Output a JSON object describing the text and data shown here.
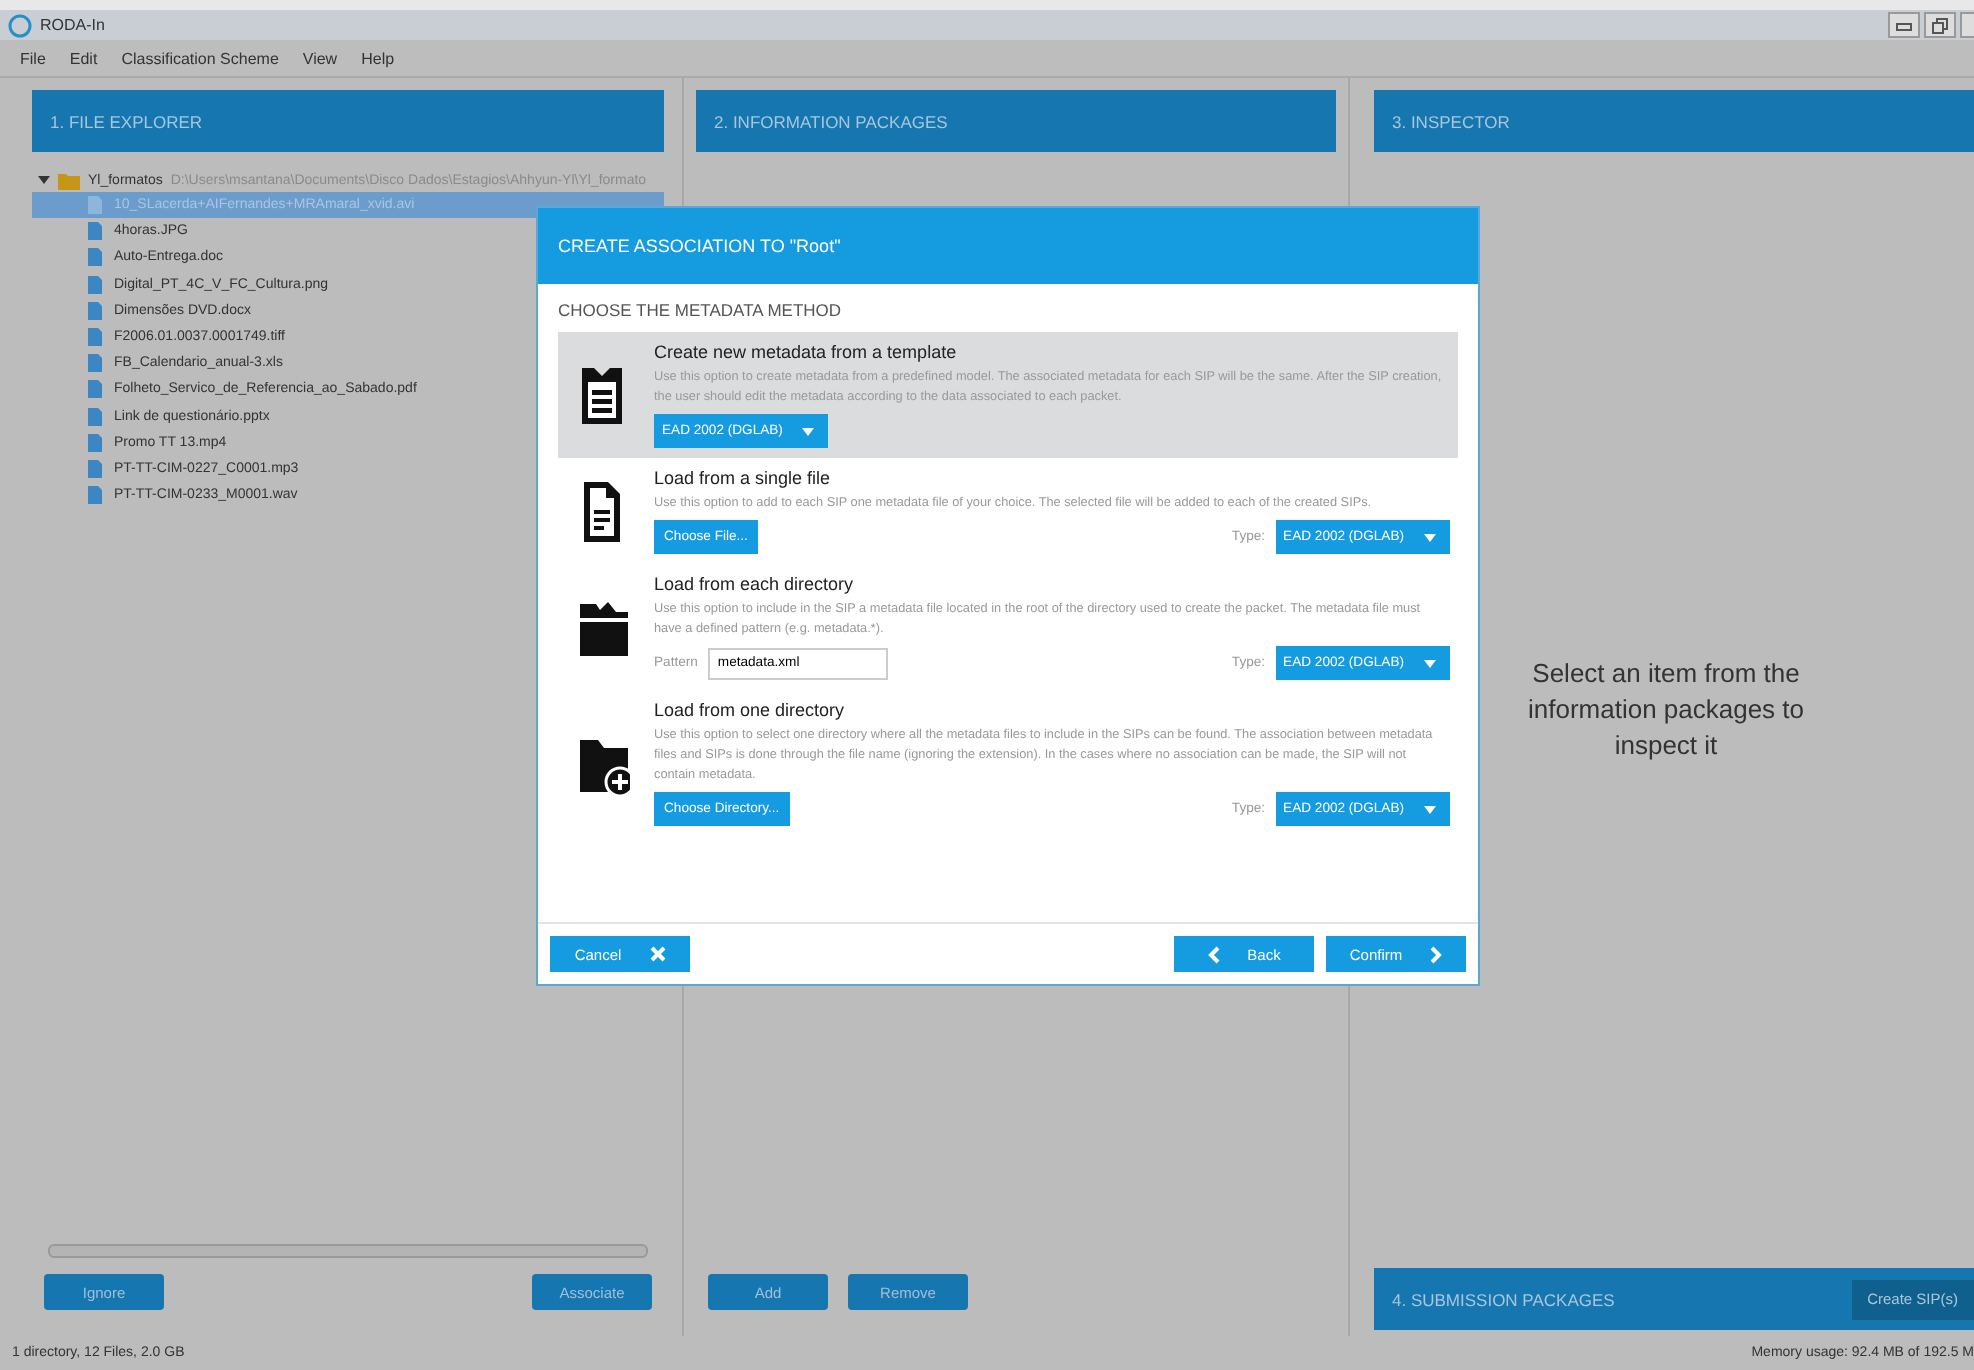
{
  "window": {
    "title": "RODA-In"
  },
  "menu": [
    "File",
    "Edit",
    "Classification Scheme",
    "View",
    "Help"
  ],
  "file_explorer": {
    "title": "1. FILE EXPLORER",
    "root": {
      "name": "Yl_formatos",
      "path": "D:\\Users\\msantana\\Documents\\Disco Dados\\Estagios\\Ahhyun-Yl\\Yl_formato",
      "expanded": true,
      "children": [
        {
          "name": "10_SLacerda+AIFernandes+MRAmaral_xvid.avi",
          "selected": true
        },
        {
          "name": "4horas.JPG",
          "selected": false
        },
        {
          "name": "Auto-Entrega.doc",
          "selected": false
        },
        {
          "name": "Digital_PT_4C_V_FC_Cultura.png",
          "selected": false
        },
        {
          "name": "Dimensões DVD.docx",
          "selected": false
        },
        {
          "name": "F2006.01.0037.0001749.tiff",
          "selected": false
        },
        {
          "name": "FB_Calendario_anual-3.xls",
          "selected": false
        },
        {
          "name": "Folheto_Servico_de_Referencia_ao_Sabado.pdf",
          "selected": false
        },
        {
          "name": "Link de questionário.pptx",
          "selected": false
        },
        {
          "name": "Promo TT 13.mp4",
          "selected": false
        },
        {
          "name": "PT-TT-CIM-0227_C0001.mp3",
          "selected": false
        },
        {
          "name": "PT-TT-CIM-0233_M0001.wav",
          "selected": false
        }
      ]
    },
    "buttons": [
      "Ignore",
      "Associate"
    ]
  },
  "information_packages": {
    "title": "2. INFORMATION PACKAGES",
    "buttons": [
      "Add",
      "Remove"
    ]
  },
  "inspector": {
    "title": "3. INSPECTOR",
    "message": "Select an item from the information packages to inspect it"
  },
  "submission_packages": {
    "title": "4. SUBMISSION PACKAGES",
    "button": "Create SIP(s)"
  },
  "status_bar": {
    "left": "1 directory, 12 Files, 2.0 GB",
    "right": "Memory usage: 92.4 MB of 192.5 M"
  },
  "dialog": {
    "title": "CREATE ASSOCIATION TO \"Root\"",
    "subtitle": "CHOOSE THE METADATA METHOD",
    "options": [
      {
        "kind": "template",
        "selected": true,
        "title": "Create new metadata from a template",
        "description": "Use this option to create metadata from a predefined model. The associated metadata for each SIP will be the same. After the SIP creation, the user should edit the metadata according to the data associated to each packet.",
        "dropdown": "EAD 2002 (DGLAB)"
      },
      {
        "kind": "file",
        "selected": false,
        "title": "Load from a single file",
        "description": "Use this option to add to each SIP one metadata file of your choice. The selected file will be added to each of the created SIPs.",
        "button": "Choose File...",
        "type_label": "Type:",
        "type_value": "EAD 2002 (DGLAB)"
      },
      {
        "kind": "each_directory",
        "selected": false,
        "title": "Load from each directory",
        "description": "Use this option to include in the SIP a metadata file located in the root of the directory used to create the packet. The metadata file must have a defined pattern (e.g. metadata.*).",
        "pattern_label": "Pattern",
        "pattern_value": "metadata.xml",
        "type_label": "Type:",
        "type_value": "EAD 2002 (DGLAB)"
      },
      {
        "kind": "one_directory",
        "selected": false,
        "title": "Load from one directory",
        "description": "Use this option to select one directory where all the metadata files to include in the SIPs can be found. The association between metadata files and SIPs is done through the file name (ignoring the extension). In the cases where no association can be made, the SIP will not contain metadata.",
        "button": "Choose Directory...",
        "type_label": "Type:",
        "type_value": "EAD 2002 (DGLAB)"
      }
    ],
    "cancel": "Cancel",
    "back": "Back",
    "confirm": "Confirm"
  }
}
